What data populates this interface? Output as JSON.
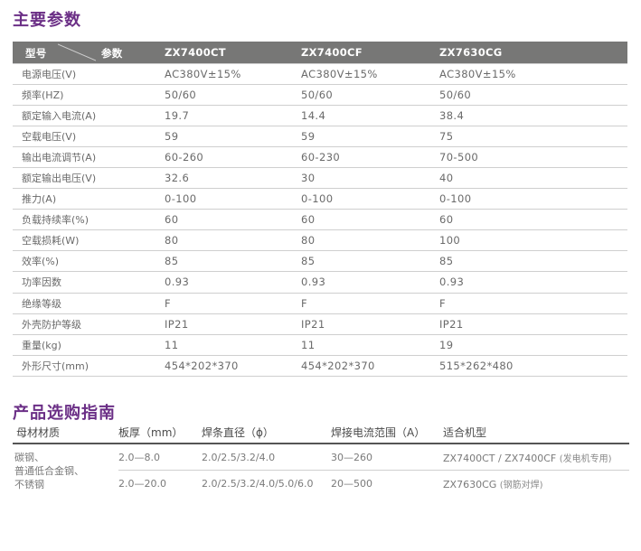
{
  "spec_section": {
    "title": "主要参数",
    "header": {
      "type_label": "型号",
      "param_label": "参数",
      "models": [
        "ZX7400CT",
        "ZX7400CF",
        "ZX7630CG"
      ]
    },
    "rows": [
      {
        "label": "电源电压(V)",
        "values": [
          "AC380V±15%",
          "AC380V±15%",
          "AC380V±15%"
        ]
      },
      {
        "label": "频率(HZ)",
        "values": [
          "50/60",
          "50/60",
          "50/60"
        ]
      },
      {
        "label": "额定输入电流(A)",
        "values": [
          "19.7",
          "14.4",
          "38.4"
        ]
      },
      {
        "label": "空载电压(V)",
        "values": [
          "59",
          "59",
          "75"
        ]
      },
      {
        "label": "输出电流调节(A)",
        "values": [
          "60-260",
          "60-230",
          "70-500"
        ]
      },
      {
        "label": "额定输出电压(V)",
        "values": [
          "32.6",
          "30",
          "40"
        ]
      },
      {
        "label": "推力(A)",
        "values": [
          "0-100",
          "0-100",
          "0-100"
        ]
      },
      {
        "label": "负载持续率(%)",
        "values": [
          "60",
          "60",
          "60"
        ]
      },
      {
        "label": "空载损耗(W)",
        "values": [
          "80",
          "80",
          "100"
        ]
      },
      {
        "label": "效率(%)",
        "values": [
          "85",
          "85",
          "85"
        ]
      },
      {
        "label": "功率因数",
        "values": [
          "0.93",
          "0.93",
          "0.93"
        ]
      },
      {
        "label": "绝缘等级",
        "values": [
          "F",
          "F",
          "F"
        ]
      },
      {
        "label": "外壳防护等级",
        "values": [
          "IP21",
          "IP21",
          "IP21"
        ]
      },
      {
        "label": "重量(kg)",
        "values": [
          "11",
          "11",
          "19"
        ]
      },
      {
        "label": "外形尺寸(mm)",
        "values": [
          "454*202*370",
          "454*202*370",
          "515*262*480"
        ]
      }
    ]
  },
  "guide_section": {
    "title": "产品选购指南",
    "headers": [
      "母材材质",
      "板厚（mm）",
      "焊条直径（ϕ）",
      "焊接电流范围（A）",
      "适合机型"
    ],
    "material_lines": [
      "碳钢、",
      "普通低合金钢、",
      "不锈钢"
    ],
    "rows": [
      {
        "thickness": "2.0—8.0",
        "diameter": "2.0/2.5/3.2/4.0",
        "current": "30—260",
        "model": "ZX7400CT / ZX7400CF",
        "note": "(发电机专用)"
      },
      {
        "thickness": "2.0—20.0",
        "diameter": "2.0/2.5/3.2/4.0/5.0/6.0",
        "current": "20—500",
        "model": "ZX7630CG",
        "note": "(钢筋对焊)"
      }
    ]
  },
  "colors": {
    "title": "#6b2f86",
    "header_bg": "#777776",
    "divider": "#cfcfcf"
  }
}
